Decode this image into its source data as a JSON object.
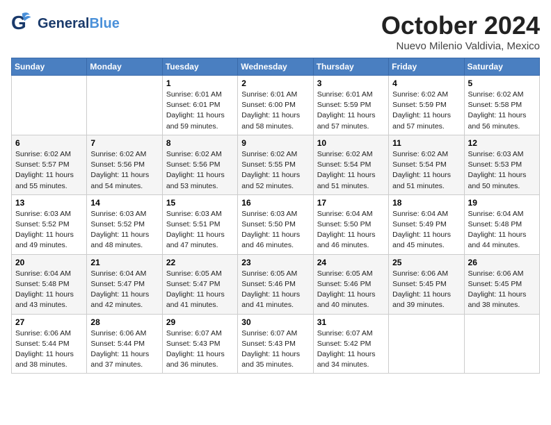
{
  "header": {
    "logo_general": "General",
    "logo_blue": "Blue",
    "month_title": "October 2024",
    "location": "Nuevo Milenio Valdivia, Mexico"
  },
  "weekdays": [
    "Sunday",
    "Monday",
    "Tuesday",
    "Wednesday",
    "Thursday",
    "Friday",
    "Saturday"
  ],
  "weeks": [
    [
      {
        "day": "",
        "info": ""
      },
      {
        "day": "",
        "info": ""
      },
      {
        "day": "1",
        "info": "Sunrise: 6:01 AM\nSunset: 6:01 PM\nDaylight: 11 hours and 59 minutes."
      },
      {
        "day": "2",
        "info": "Sunrise: 6:01 AM\nSunset: 6:00 PM\nDaylight: 11 hours and 58 minutes."
      },
      {
        "day": "3",
        "info": "Sunrise: 6:01 AM\nSunset: 5:59 PM\nDaylight: 11 hours and 57 minutes."
      },
      {
        "day": "4",
        "info": "Sunrise: 6:02 AM\nSunset: 5:59 PM\nDaylight: 11 hours and 57 minutes."
      },
      {
        "day": "5",
        "info": "Sunrise: 6:02 AM\nSunset: 5:58 PM\nDaylight: 11 hours and 56 minutes."
      }
    ],
    [
      {
        "day": "6",
        "info": "Sunrise: 6:02 AM\nSunset: 5:57 PM\nDaylight: 11 hours and 55 minutes."
      },
      {
        "day": "7",
        "info": "Sunrise: 6:02 AM\nSunset: 5:56 PM\nDaylight: 11 hours and 54 minutes."
      },
      {
        "day": "8",
        "info": "Sunrise: 6:02 AM\nSunset: 5:56 PM\nDaylight: 11 hours and 53 minutes."
      },
      {
        "day": "9",
        "info": "Sunrise: 6:02 AM\nSunset: 5:55 PM\nDaylight: 11 hours and 52 minutes."
      },
      {
        "day": "10",
        "info": "Sunrise: 6:02 AM\nSunset: 5:54 PM\nDaylight: 11 hours and 51 minutes."
      },
      {
        "day": "11",
        "info": "Sunrise: 6:02 AM\nSunset: 5:54 PM\nDaylight: 11 hours and 51 minutes."
      },
      {
        "day": "12",
        "info": "Sunrise: 6:03 AM\nSunset: 5:53 PM\nDaylight: 11 hours and 50 minutes."
      }
    ],
    [
      {
        "day": "13",
        "info": "Sunrise: 6:03 AM\nSunset: 5:52 PM\nDaylight: 11 hours and 49 minutes."
      },
      {
        "day": "14",
        "info": "Sunrise: 6:03 AM\nSunset: 5:52 PM\nDaylight: 11 hours and 48 minutes."
      },
      {
        "day": "15",
        "info": "Sunrise: 6:03 AM\nSunset: 5:51 PM\nDaylight: 11 hours and 47 minutes."
      },
      {
        "day": "16",
        "info": "Sunrise: 6:03 AM\nSunset: 5:50 PM\nDaylight: 11 hours and 46 minutes."
      },
      {
        "day": "17",
        "info": "Sunrise: 6:04 AM\nSunset: 5:50 PM\nDaylight: 11 hours and 46 minutes."
      },
      {
        "day": "18",
        "info": "Sunrise: 6:04 AM\nSunset: 5:49 PM\nDaylight: 11 hours and 45 minutes."
      },
      {
        "day": "19",
        "info": "Sunrise: 6:04 AM\nSunset: 5:48 PM\nDaylight: 11 hours and 44 minutes."
      }
    ],
    [
      {
        "day": "20",
        "info": "Sunrise: 6:04 AM\nSunset: 5:48 PM\nDaylight: 11 hours and 43 minutes."
      },
      {
        "day": "21",
        "info": "Sunrise: 6:04 AM\nSunset: 5:47 PM\nDaylight: 11 hours and 42 minutes."
      },
      {
        "day": "22",
        "info": "Sunrise: 6:05 AM\nSunset: 5:47 PM\nDaylight: 11 hours and 41 minutes."
      },
      {
        "day": "23",
        "info": "Sunrise: 6:05 AM\nSunset: 5:46 PM\nDaylight: 11 hours and 41 minutes."
      },
      {
        "day": "24",
        "info": "Sunrise: 6:05 AM\nSunset: 5:46 PM\nDaylight: 11 hours and 40 minutes."
      },
      {
        "day": "25",
        "info": "Sunrise: 6:06 AM\nSunset: 5:45 PM\nDaylight: 11 hours and 39 minutes."
      },
      {
        "day": "26",
        "info": "Sunrise: 6:06 AM\nSunset: 5:45 PM\nDaylight: 11 hours and 38 minutes."
      }
    ],
    [
      {
        "day": "27",
        "info": "Sunrise: 6:06 AM\nSunset: 5:44 PM\nDaylight: 11 hours and 38 minutes."
      },
      {
        "day": "28",
        "info": "Sunrise: 6:06 AM\nSunset: 5:44 PM\nDaylight: 11 hours and 37 minutes."
      },
      {
        "day": "29",
        "info": "Sunrise: 6:07 AM\nSunset: 5:43 PM\nDaylight: 11 hours and 36 minutes."
      },
      {
        "day": "30",
        "info": "Sunrise: 6:07 AM\nSunset: 5:43 PM\nDaylight: 11 hours and 35 minutes."
      },
      {
        "day": "31",
        "info": "Sunrise: 6:07 AM\nSunset: 5:42 PM\nDaylight: 11 hours and 34 minutes."
      },
      {
        "day": "",
        "info": ""
      },
      {
        "day": "",
        "info": ""
      }
    ]
  ]
}
